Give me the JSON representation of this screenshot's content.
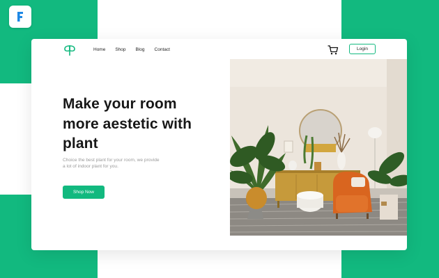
{
  "badge": {
    "icon": "figma-f-icon",
    "color": "#1e88e5"
  },
  "colors": {
    "accent": "#12b97f",
    "text": "#171717",
    "muted": "#9a9a9a"
  },
  "header": {
    "logo_icon": "leaf-logo-icon",
    "nav": [
      "Home",
      "Shop",
      "Blog",
      "Contact"
    ],
    "cart_icon": "cart-icon",
    "login_label": "Login"
  },
  "hero": {
    "headline_lines": [
      "Make your room",
      "more aestetic with",
      "plant"
    ],
    "subtext_lines": [
      "Choice the best plant for your room, we provide",
      "a lot of indoor plant for you."
    ],
    "cta_label": "Shop Now",
    "image": "living-room-with-plants-photo"
  }
}
